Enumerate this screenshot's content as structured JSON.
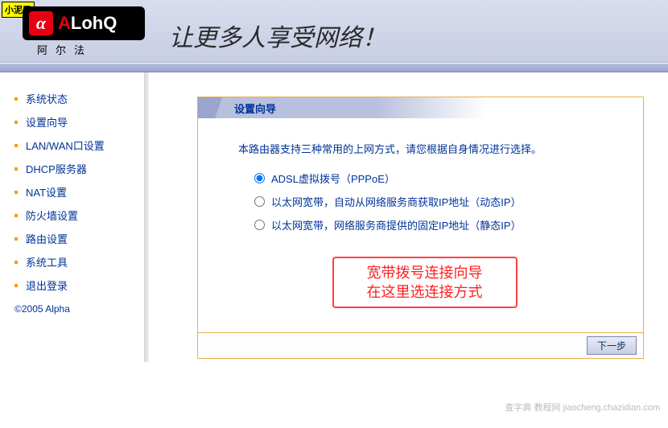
{
  "header": {
    "tag": "小泥巴",
    "logo_char": "α",
    "logo_text_a": "A",
    "logo_text_rest": "LohQ",
    "logo_sub": "阿尔法",
    "slogan": "让更多人享受网络！"
  },
  "sidebar": {
    "items": [
      "系统状态",
      "设置向导",
      "LAN/WAN口设置",
      "DHCP服务器",
      "NAT设置",
      "防火墙设置",
      "路由设置",
      "系统工具",
      "退出登录"
    ],
    "copyright": "©2005 Alpha"
  },
  "wizard": {
    "title": "设置向导",
    "instruction": "本路由器支持三种常用的上网方式，请您根据自身情况进行选择。",
    "options": [
      {
        "label": "ADSL虚拟拨号（PPPoE）",
        "checked": true
      },
      {
        "label": "以太网宽带，自动从网络服务商获取IP地址（动态IP）",
        "checked": false
      },
      {
        "label": "以太网宽带，网络服务商提供的固定IP地址（静态IP）",
        "checked": false
      }
    ],
    "annotation": {
      "line1": "宽带拨号连接向导",
      "line2": "在这里选连接方式"
    },
    "next_button": "下一步"
  },
  "watermark": "查字典 教程网  jiaocheng.chazidian.com"
}
